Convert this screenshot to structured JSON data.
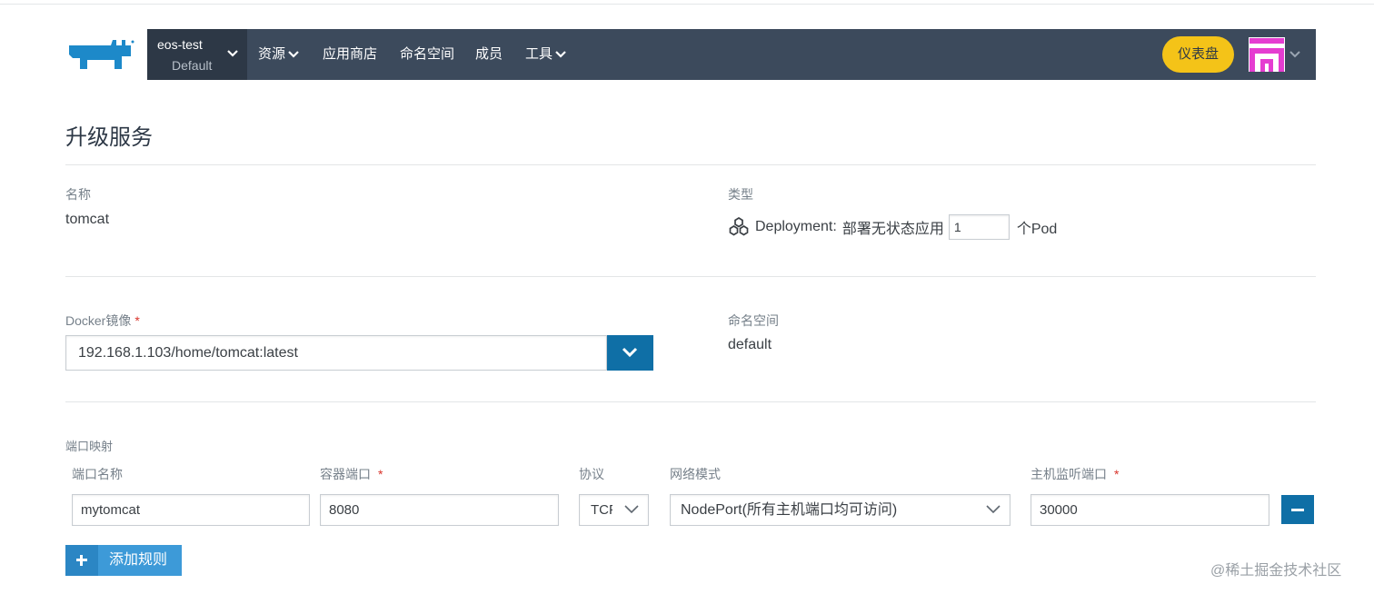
{
  "header": {
    "environment": {
      "name": "eos-test",
      "sub": "Default"
    },
    "nav": [
      {
        "label": "资源",
        "has_dropdown": true
      },
      {
        "label": "应用商店",
        "has_dropdown": false
      },
      {
        "label": "命名空间",
        "has_dropdown": false
      },
      {
        "label": "成员",
        "has_dropdown": false
      },
      {
        "label": "工具",
        "has_dropdown": true
      }
    ],
    "dashboard_label": "仪表盘",
    "colors": {
      "bar": "#3c4a5c",
      "env": "#2d3846",
      "dashboard": "#f4c318",
      "avatar": "#e53dd1"
    }
  },
  "page": {
    "title": "升级服务",
    "name": {
      "label": "名称",
      "value": "tomcat"
    },
    "type": {
      "label": "类型",
      "kind": "Deployment:",
      "desc": "部署无状态应用",
      "replicas": "1",
      "unit": "个Pod",
      "icon": "deployment-icon"
    },
    "image": {
      "label": "Docker镜像",
      "required_mark": "*",
      "value": "192.168.1.103/home/tomcat:latest"
    },
    "namespace": {
      "label": "命名空间",
      "value": "default"
    },
    "ports": {
      "section_label": "端口映射",
      "headers": {
        "name": "端口名称",
        "container_port": "容器端口",
        "protocol": "协议",
        "network_mode": "网络模式",
        "host_port": "主机监听端口"
      },
      "required_mark": "*",
      "row": {
        "name": "mytomcat",
        "container_port": "8080",
        "protocol": "TCP",
        "network_mode": "NodePort(所有主机端口均可访问)",
        "host_port": "30000"
      }
    },
    "add_rule_label": "添加规则",
    "accent": "#0f6fa6"
  },
  "watermark": "@稀土掘金技术社区"
}
